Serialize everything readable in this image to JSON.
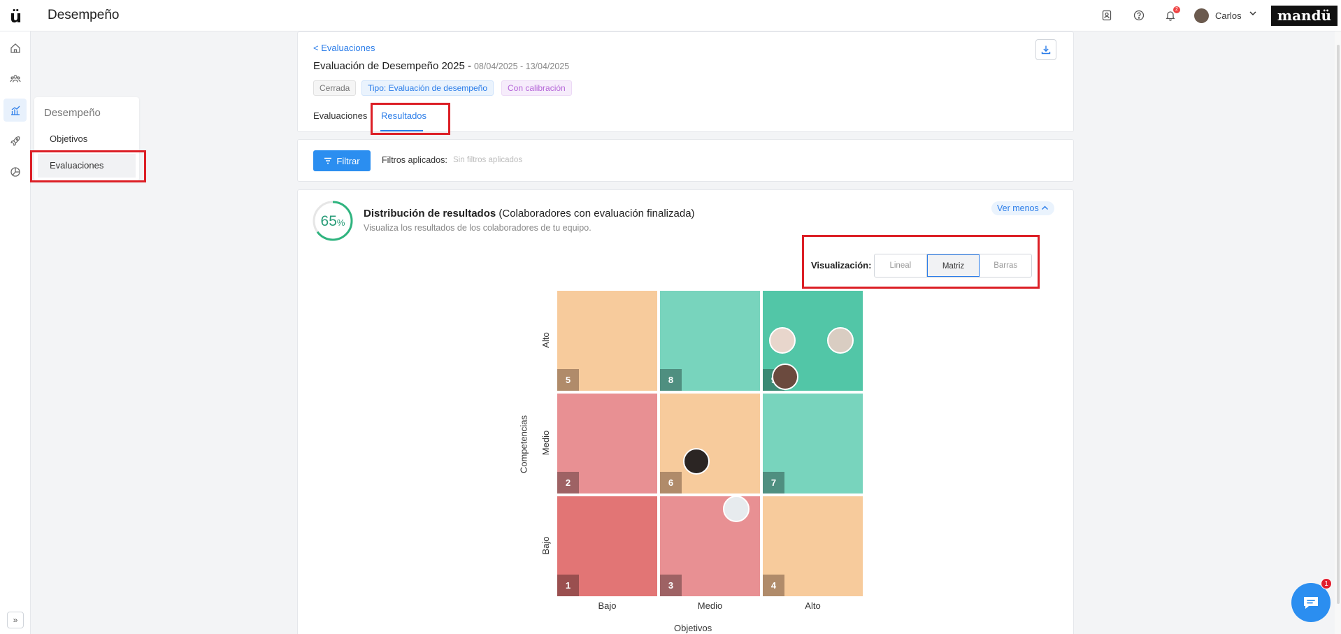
{
  "header": {
    "logo": "ü",
    "title": "Desempeño",
    "user_name": "Carlos",
    "brand": "mandü",
    "notifications_count": "2"
  },
  "rail": {
    "icons": [
      "home-icon",
      "team-icon",
      "chart-icon",
      "rocket-icon",
      "pie-chart-icon"
    ],
    "expand": "»"
  },
  "submenu": {
    "title": "Desempeño",
    "items": [
      {
        "label": "Objetivos"
      },
      {
        "label": "Evaluaciones"
      }
    ]
  },
  "evaluation": {
    "back_link": "< Evaluaciones",
    "title": "Evaluación de Desempeño 2025 -",
    "dates": "08/04/2025 - 13/04/2025",
    "tags": [
      {
        "label": "Cerrada",
        "color": "#777777",
        "bg": "#f5f5f5",
        "border": "#e0e0e0"
      },
      {
        "label": "Tipo: Evaluación de desempeño",
        "color": "#2b7de9",
        "bg": "#eaf3fd",
        "border": "#cfe3fb"
      },
      {
        "label": "Con calibración",
        "color": "#b565d8",
        "bg": "#f6ecfb",
        "border": "#ecd9f6"
      }
    ],
    "tabs": [
      {
        "label": "Evaluaciones"
      },
      {
        "label": "Resultados"
      }
    ]
  },
  "filters": {
    "button": "Filtrar",
    "label": "Filtros aplicados:",
    "value": "Sin filtros aplicados"
  },
  "distribution": {
    "percent": "65",
    "percent_sign": "%",
    "percent_value": 65,
    "title_bold": "Distribución de resultados",
    "title_rest": " (Colaboradores con evaluación finalizada)",
    "subtitle": "Visualiza los resultados de los colaboradores de tu equipo.",
    "toggle": "Ver menos",
    "visualization_label": "Visualización:",
    "visualization_options": [
      {
        "label": "Lineal"
      },
      {
        "label": "Matriz"
      },
      {
        "label": "Barras"
      }
    ]
  },
  "matrix": {
    "x_title": "Objetivos",
    "y_title": "Competencias",
    "x_labels": [
      "Bajo",
      "Medio",
      "Alto"
    ],
    "y_labels": [
      "Alto",
      "Medio",
      "Bajo"
    ],
    "cells": [
      {
        "num": "5",
        "color": "#f7cb9c",
        "tag_color": "#b08b6a",
        "row": 0,
        "col": 0
      },
      {
        "num": "8",
        "color": "#78d4bd",
        "tag_color": "#4f8f80",
        "row": 0,
        "col": 1
      },
      {
        "num": "9",
        "color": "#52c6a7",
        "tag_color": "#3b8a74",
        "row": 0,
        "col": 2
      },
      {
        "num": "2",
        "color": "#e89093",
        "tag_color": "#9e6264",
        "row": 1,
        "col": 0
      },
      {
        "num": "6",
        "color": "#f7cb9c",
        "tag_color": "#b08b6a",
        "row": 1,
        "col": 1
      },
      {
        "num": "7",
        "color": "#78d4bd",
        "tag_color": "#4f8f80",
        "row": 1,
        "col": 2
      },
      {
        "num": "1",
        "color": "#e27575",
        "tag_color": "#9a4f4f",
        "row": 2,
        "col": 0
      },
      {
        "num": "3",
        "color": "#e89093",
        "tag_color": "#9e6264",
        "row": 2,
        "col": 1
      },
      {
        "num": "4",
        "color": "#f7cb9c",
        "tag_color": "#b08b6a",
        "row": 2,
        "col": 2
      }
    ]
  },
  "chat": {
    "badge": "1"
  }
}
